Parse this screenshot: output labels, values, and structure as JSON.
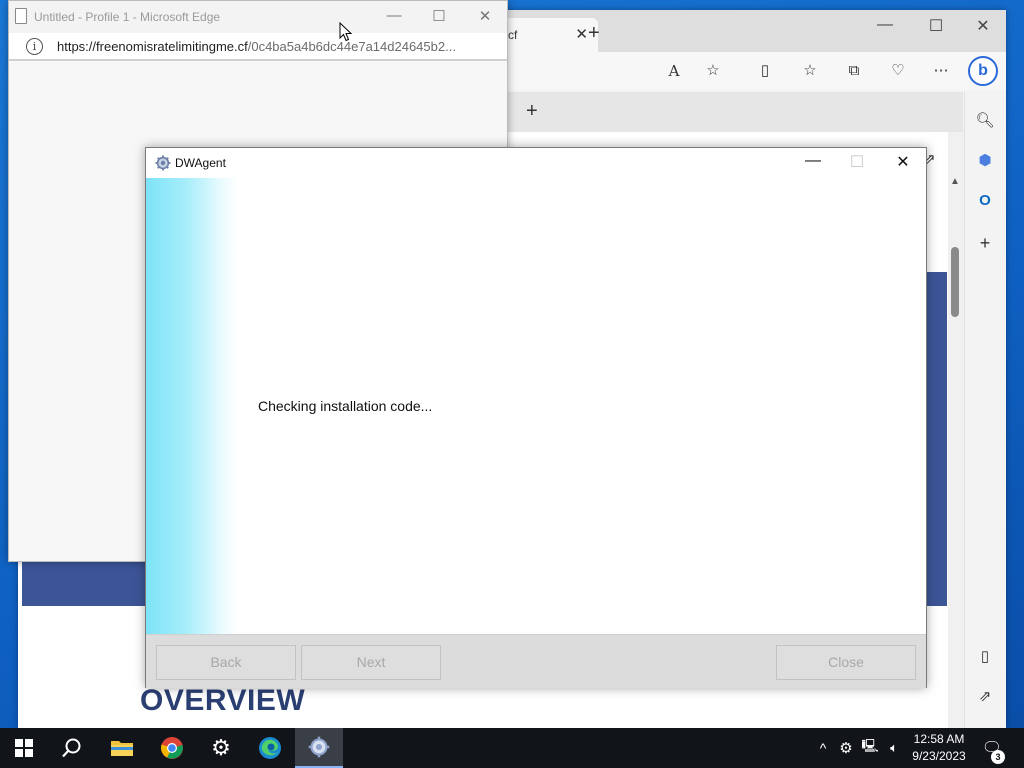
{
  "desktop": {},
  "edge_background": {
    "tab_title": "cf",
    "new_tab_symbol": "+",
    "window_controls": {
      "minimize": "—",
      "maximize": "☐",
      "close": "✕"
    },
    "toolbar_icons": [
      "read-aloud",
      "favorite-star",
      "split-screen",
      "favorites",
      "collections",
      "browser-essentials",
      "more"
    ],
    "toolbar_glyphs": {
      "read_aloud": "A",
      "more": "⋯"
    },
    "bing_label": "b",
    "inner_new_tab": "+",
    "overview_heading": "OVERVIEW",
    "sidebar_icons": [
      "search",
      "copilot",
      "outlook",
      "add"
    ]
  },
  "popup": {
    "title": "Untitled - Profile 1 - Microsoft Edge",
    "url_domain": "https://freenomisratelimitingme.cf",
    "url_path": "/0c4ba5a4b6dc44e7a14d24645b2...",
    "info_symbol": "i",
    "window_controls": {
      "minimize": "—",
      "maximize": "☐",
      "close": "✕"
    }
  },
  "dwagent": {
    "title": "DWAgent",
    "status_text": "Checking installation code...",
    "window_controls": {
      "minimize": "—",
      "maximize": "☐",
      "close": "✕"
    },
    "buttons": {
      "back": "Back",
      "next": "Next",
      "close": "Close"
    },
    "colors": {
      "side_gradient_start": "#7de3f7",
      "footer": "#dcdcdc"
    }
  },
  "taskbar": {
    "apps": [
      "start",
      "search",
      "file-explorer",
      "chrome",
      "settings",
      "edge",
      "dwagent"
    ],
    "tray_chevron": "^",
    "clock": {
      "time": "12:58 AM",
      "date": "9/23/2023"
    },
    "notification_count": "3"
  }
}
